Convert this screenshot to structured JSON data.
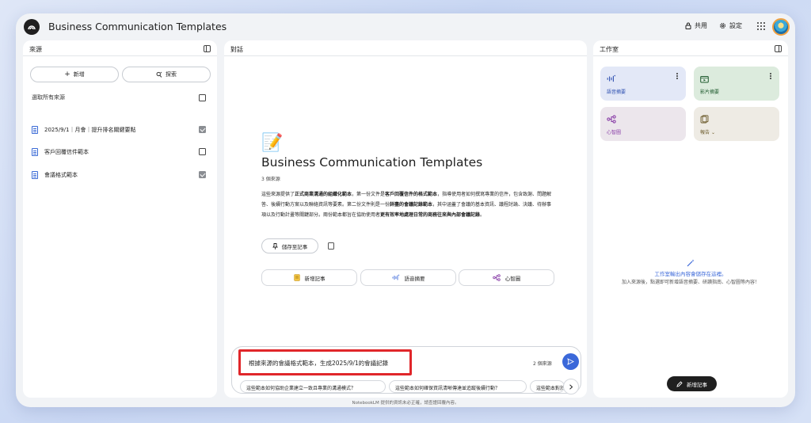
{
  "app": {
    "title": "Business Communication Templates"
  },
  "header": {
    "share_label": "共用",
    "settings_label": "設定"
  },
  "sources": {
    "title": "來源",
    "add_label": "新增",
    "search_label": "探索",
    "select_all_label": "選取所有來源",
    "items": [
      {
        "label": "2025/9/1｜月會｜提升排名關鍵要點",
        "checked": true
      },
      {
        "label": "客戶回覆信件範本",
        "checked": false
      },
      {
        "label": "會議格式範本",
        "checked": true
      }
    ]
  },
  "chat": {
    "title": "對話",
    "emoji": "📝",
    "notebook_title": "Business Communication Templates",
    "source_count": "3 個來源",
    "summary": {
      "p1": "這些來源提供了",
      "b1": "正式商業溝通的組織化範本",
      "p2": "，第一份文件是",
      "b2": "客戶回覆信件的格式範本",
      "p3": "，指導使用者如何撰寫專業的信件，包含致謝、問題解答、後續行動方案以及聯絡資訊等要素。第二份文件則是一份",
      "b3": "詳盡的會議記錄範本",
      "p4": "，其中涵蓋了會議的基本資訊、議程討論、決議、待辦事項以及行動計畫等關鍵部分。兩份範本都旨在協助使用者",
      "b4": "更有效率地處理日常的商務往來與內部會議記錄",
      "p5": "。"
    },
    "save_note_label": "儲存至記事",
    "actions": [
      "新增記事",
      "語音摘要",
      "心智圖"
    ],
    "input": {
      "query": "根據來源的會議格式範本，生成2025/9/1的會議記錄",
      "source_count": "2 個來源"
    },
    "suggestions": [
      "這些範本如何協助企業建立一致且專業的溝通模式？",
      "這些範本如何確保資訊清晰傳達並追蹤後續行動？",
      "這些範本對於…"
    ]
  },
  "studio": {
    "title": "工作室",
    "tiles": [
      {
        "label": "語音摘要",
        "color": "#e3e8f7"
      },
      {
        "label": "影片摘要",
        "color": "#dcebdd"
      },
      {
        "label": "心智圖",
        "color": "#ece6ec"
      },
      {
        "label": "報告",
        "color": "#eeebe4"
      }
    ],
    "hint_title": "工作室輸出內容會儲存在這裡。",
    "hint_body": "加入來源後，點選即可新增語音摘要、研讀指南、心智圖等內容！",
    "add_note_label": "新增記事"
  },
  "footer": {
    "disclaimer": "NotebookLM 提供的資訊未必正確，請查證回覆內容。"
  },
  "colors": {
    "accent": "#3b68d9",
    "highlight_border": "#e0262a"
  }
}
